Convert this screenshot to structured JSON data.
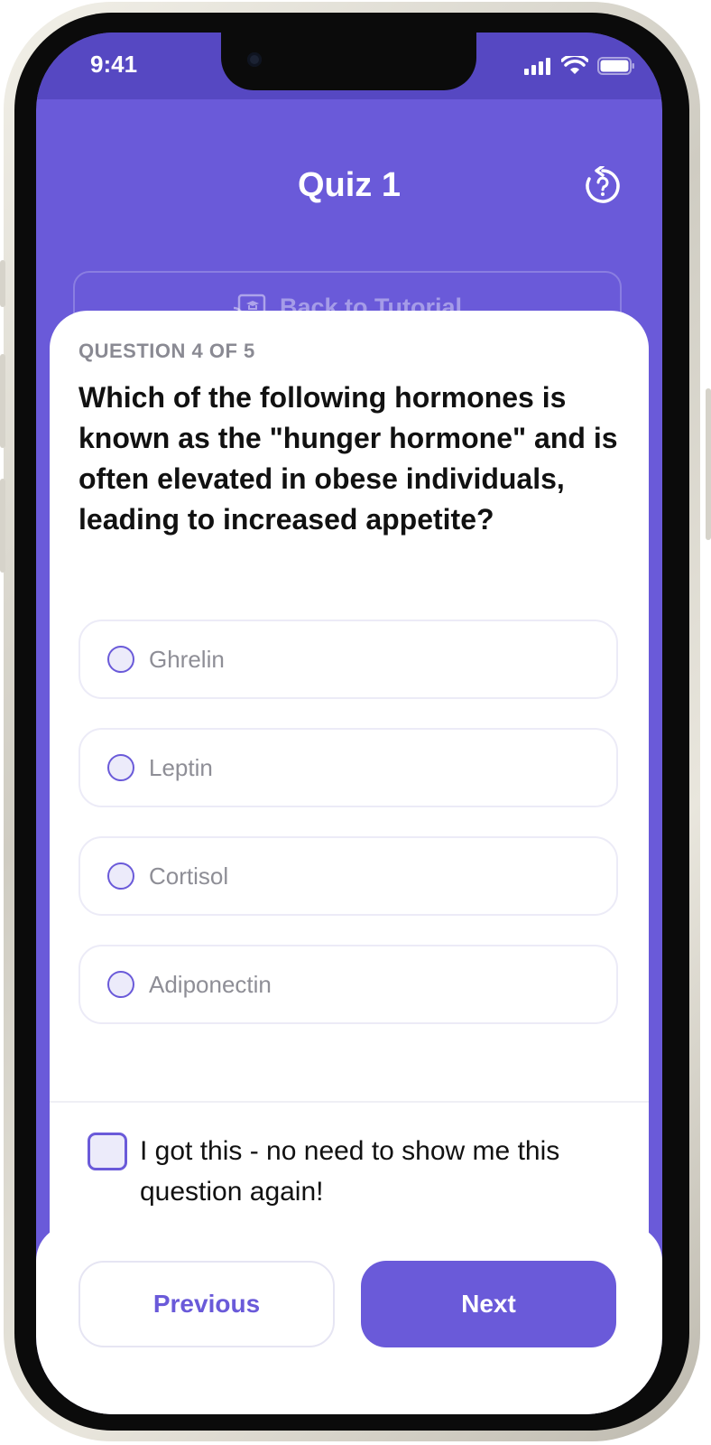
{
  "status": {
    "time": "9:41"
  },
  "header": {
    "title": "Quiz 1",
    "back_label": "Back to Tutorial"
  },
  "question": {
    "counter": "QUESTION 4 OF 5",
    "text": "Which of the following hormones is known as the \"hunger hormone\" and is often elevated in obese individuals, leading to increased appetite?",
    "options": [
      "Ghrelin",
      "Leptin",
      "Cortisol",
      "Adiponectin"
    ]
  },
  "skip": {
    "label": "I got this - no need to show me this question again!",
    "checked": false
  },
  "footer": {
    "previous_label": "Previous",
    "next_label": "Next"
  },
  "colors": {
    "accent": "#6a5ad9",
    "status_bar": "#5648c2",
    "option_border": "#ecebf7"
  },
  "icons": {
    "retry": "refresh-question-icon",
    "back": "cast-education-icon"
  }
}
